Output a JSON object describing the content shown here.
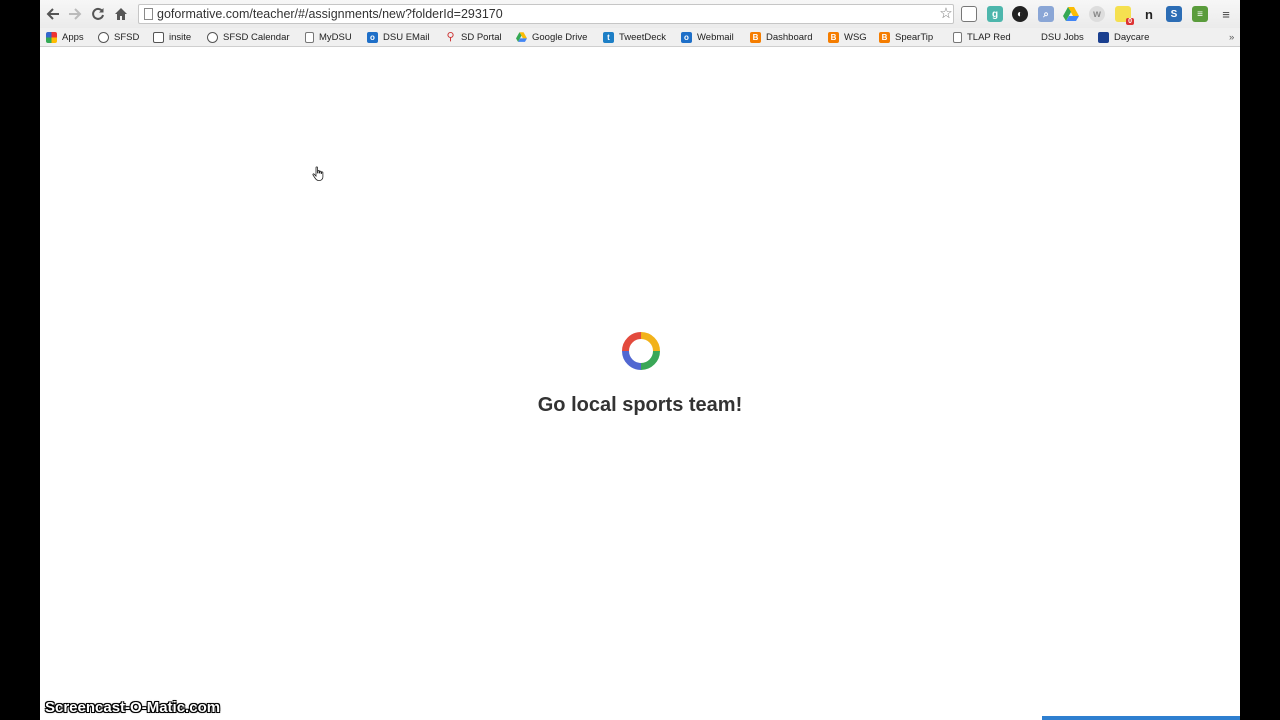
{
  "browser": {
    "url": "goformative.com/teacher/#/assignments/new?folderId=293170",
    "bookmarks": [
      {
        "label": "Apps",
        "icon": "apps-grid-icon"
      },
      {
        "label": "SFSD",
        "icon": "soccer-ball-icon"
      },
      {
        "label": "insite",
        "icon": "calendar-icon"
      },
      {
        "label": "SFSD Calendar",
        "icon": "soccer-ball-icon"
      },
      {
        "label": "MyDSU",
        "icon": "page-icon"
      },
      {
        "label": "DSU EMail",
        "icon": "outlook-icon"
      },
      {
        "label": "SD Portal",
        "icon": "pin-icon"
      },
      {
        "label": "Google Drive",
        "icon": "google-drive-icon"
      },
      {
        "label": "TweetDeck",
        "icon": "tweetdeck-icon"
      },
      {
        "label": "Webmail",
        "icon": "outlook-icon"
      },
      {
        "label": "Dashboard",
        "icon": "blogger-icon"
      },
      {
        "label": "WSG",
        "icon": "blogger-icon"
      },
      {
        "label": "SpearTip",
        "icon": "blogger-icon"
      },
      {
        "label": "TLAP Red",
        "icon": "page-icon"
      },
      {
        "label": "DSU Jobs",
        "icon": ""
      },
      {
        "label": "Daycare",
        "icon": "daycare-icon"
      }
    ],
    "extension_badges": {
      "notes": "0"
    }
  },
  "page": {
    "loading_message": "Go local sports team!"
  },
  "watermark": "Screencast-O-Matic.com",
  "colors": {
    "spinner": [
      "#f2b21a",
      "#3aa757",
      "#5167d1",
      "#e34a3d"
    ]
  }
}
